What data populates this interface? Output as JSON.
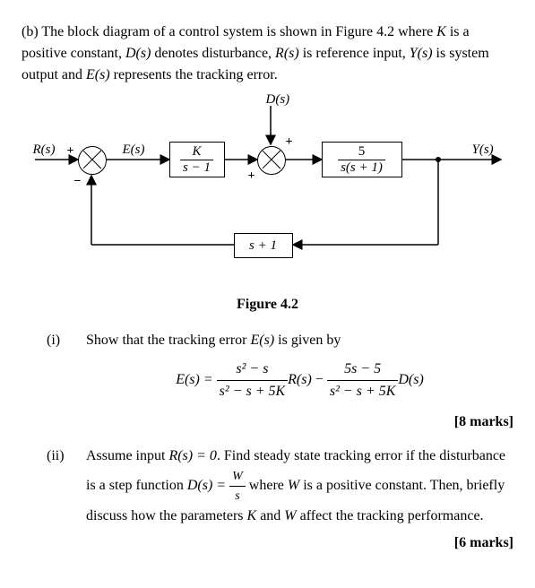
{
  "part_label": "(b)",
  "intro_text_1": "The block diagram of a control system is shown in Figure 4.2 where ",
  "intro_K": "K",
  "intro_text_2": " is a positive constant, ",
  "intro_Ds": "D(s)",
  "intro_text_3": " denotes disturbance, ",
  "intro_Rs": "R(s)",
  "intro_text_4": " is reference input, ",
  "intro_Ys": "Y(s)",
  "intro_text_5": " is system output and ",
  "intro_Es": "E(s)",
  "intro_text_6": " represents the tracking error.",
  "diagram": {
    "Ds_label": "D(s)",
    "Rs_label": "R(s)",
    "Ys_label": "Y(s)",
    "Es_label": "E(s)",
    "block1_num": "K",
    "block1_den": "s − 1",
    "block2_num": "5",
    "block2_den": "s(s + 1)",
    "feedback_block": "s + 1",
    "plus1": "+",
    "minus1": "−",
    "plus2": "+",
    "plus2b": "+"
  },
  "caption": "Figure 4.2",
  "item_i": {
    "label": "(i)",
    "text_1": "Show that the tracking error ",
    "Es": "E(s)",
    "text_2": " is given by",
    "formula_lhs": "E(s) = ",
    "frac1_num": "s² − s",
    "frac1_den": "s² − s + 5K",
    "Rs": "R(s)",
    "minus": " − ",
    "frac2_num": "5s − 5",
    "frac2_den": "s² − s + 5K",
    "Ds": "D(s)",
    "marks": "[8 marks]"
  },
  "item_ii": {
    "label": "(ii)",
    "text_1": "Assume input ",
    "Rs_eq": "R(s) = 0",
    "text_2": ". Find steady state tracking error if the disturbance is a step function ",
    "Ds_eq_lhs": "D(s) = ",
    "Ds_frac_num": "W",
    "Ds_frac_den": "s",
    "text_3": " where ",
    "W": "W",
    "text_4": " is a positive constant. Then, briefly discuss how the parameters ",
    "K": "K",
    "text_5": " and ",
    "W2": "W",
    "text_6": " affect the tracking performance.",
    "marks": "[6 marks]"
  }
}
